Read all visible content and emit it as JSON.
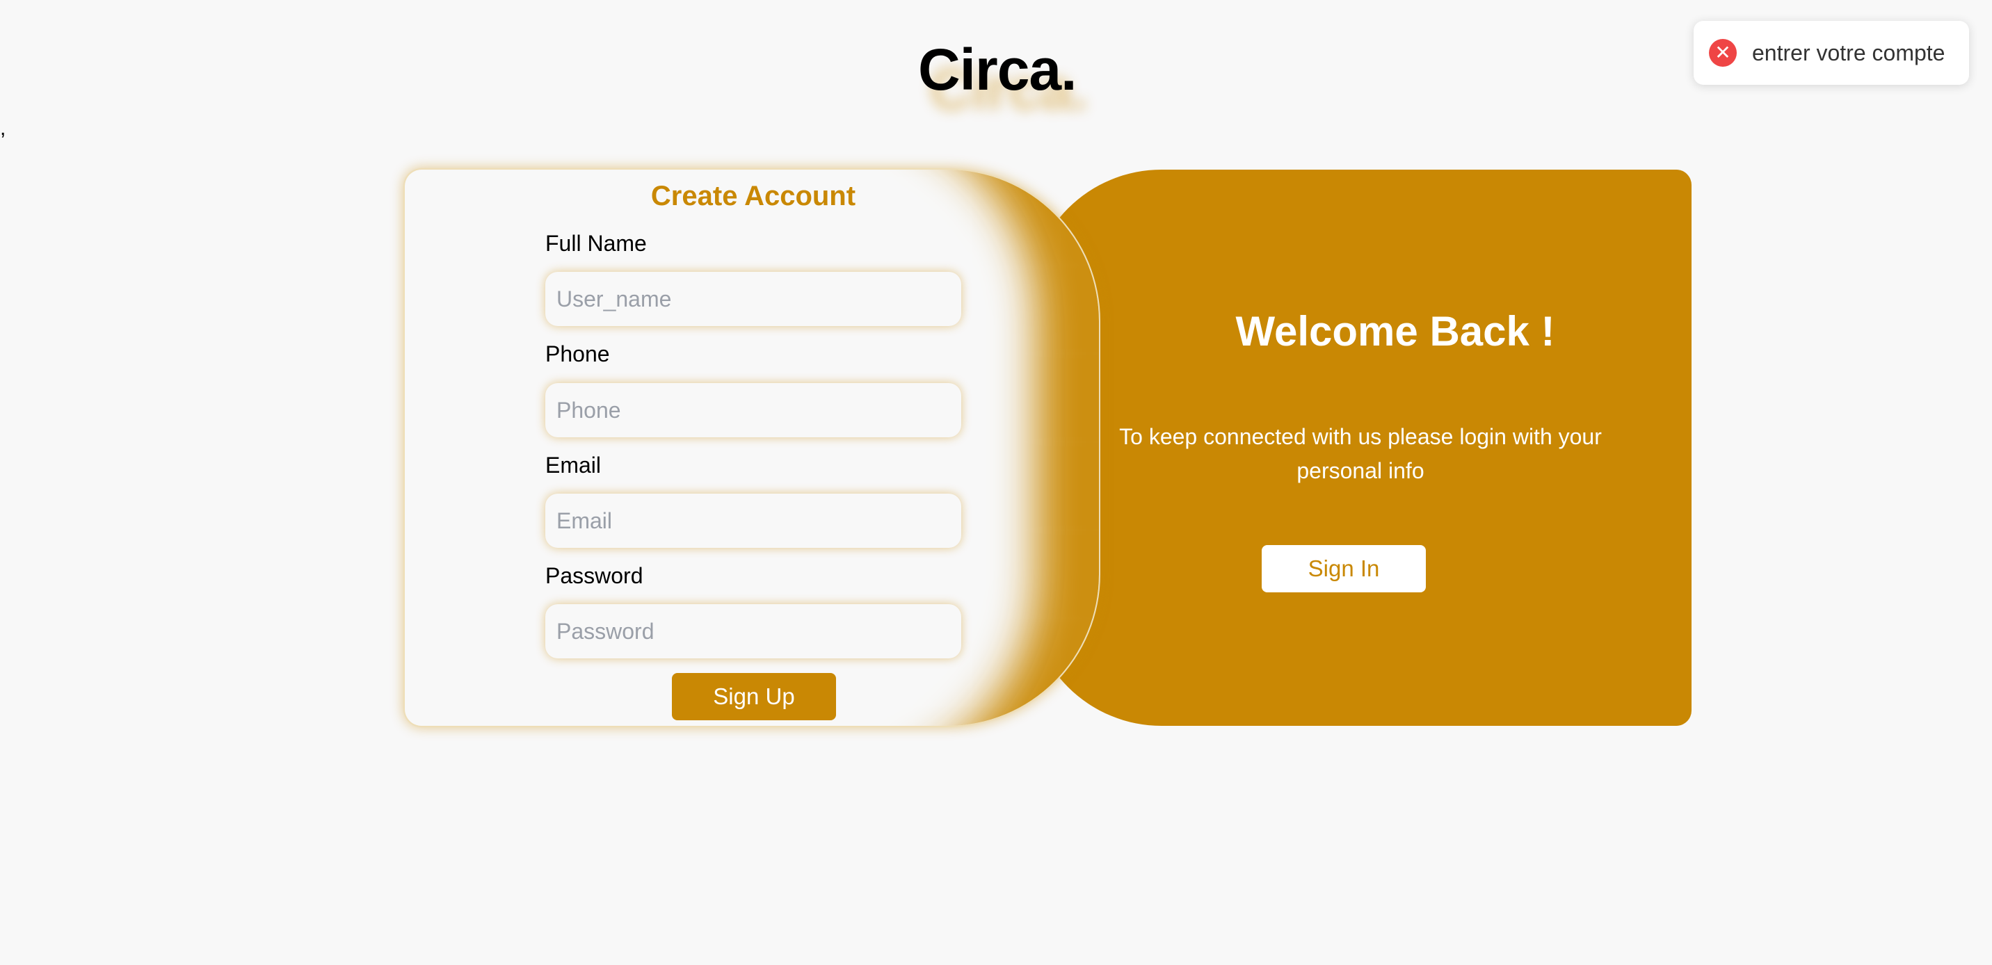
{
  "brand": "Circa.",
  "stray_text": ",",
  "toast": {
    "icon": "close-icon",
    "message": "entrer votre compte",
    "color": "#ef4545"
  },
  "signup": {
    "title": "Create Account",
    "fields": [
      {
        "label": "Full Name",
        "placeholder": "User_name"
      },
      {
        "label": "Phone",
        "placeholder": "Phone"
      },
      {
        "label": "Email",
        "placeholder": "Email"
      },
      {
        "label": "Password",
        "placeholder": "Password"
      }
    ],
    "button_label": "Sign Up"
  },
  "overlay": {
    "title": "Welcome Back !",
    "text": "To keep connected with us please login with your personal info",
    "button_label": "Sign In"
  },
  "colors": {
    "accent": "#c98804",
    "background": "#f8f8f8"
  }
}
